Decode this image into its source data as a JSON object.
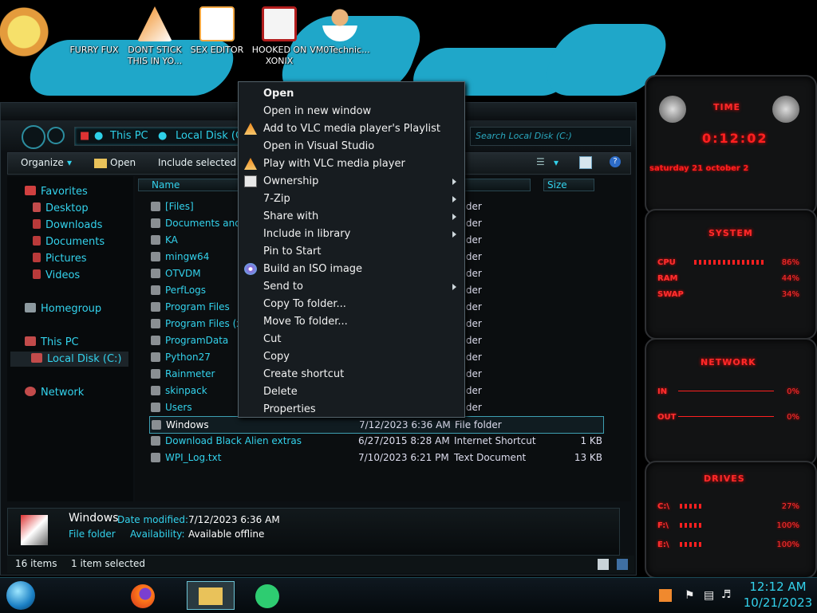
{
  "desktop": {
    "icons": [
      {
        "label": "FURRY FUX",
        "color": "#d83a2f"
      },
      {
        "label": "DONT STICK THIS IN YO...",
        "color": "#f08a1c"
      },
      {
        "label": "SEX EDITOR",
        "color": "#f2a640"
      },
      {
        "label": "HOOKED ON XONIX",
        "color": "#b31e1e"
      },
      {
        "label": "VM0Technic...",
        "color": "#e9b37a"
      }
    ]
  },
  "explorer": {
    "breadcrumb": [
      "This PC",
      "Local Disk (C:)"
    ],
    "search_placeholder": "Search Local Disk (C:)",
    "toolbar": {
      "organize": "Organize",
      "open": "Open",
      "include": "Include selected fol"
    },
    "columns": {
      "name": "Name",
      "type": "s",
      "size": "Size"
    },
    "nav": {
      "favorites": "Favorites",
      "desktop": "Desktop",
      "downloads": "Downloads",
      "documents": "Documents",
      "pictures": "Pictures",
      "videos": "Videos",
      "homegroup": "Homegroup",
      "thispc": "This PC",
      "localdisk": "Local Disk (C:)",
      "network": "Network"
    },
    "files": [
      {
        "name": "[Files]",
        "date": "",
        "type": "folder",
        "size": ""
      },
      {
        "name": "Documents and Se",
        "date": "",
        "type": "folder",
        "size": ""
      },
      {
        "name": "KA",
        "date": "",
        "type": "folder",
        "size": ""
      },
      {
        "name": "mingw64",
        "date": "",
        "type": "folder",
        "size": ""
      },
      {
        "name": "OTVDM",
        "date": "",
        "type": "folder",
        "size": ""
      },
      {
        "name": "PerfLogs",
        "date": "",
        "type": "folder",
        "size": ""
      },
      {
        "name": "Program Files",
        "date": "",
        "type": "folder",
        "size": ""
      },
      {
        "name": "Program Files (x86",
        "date": "",
        "type": "folder",
        "size": ""
      },
      {
        "name": "ProgramData",
        "date": "",
        "type": "folder",
        "size": ""
      },
      {
        "name": "Python27",
        "date": "",
        "type": "folder",
        "size": ""
      },
      {
        "name": "Rainmeter",
        "date": "",
        "type": "folder",
        "size": ""
      },
      {
        "name": "skinpack",
        "date": "",
        "type": "folder",
        "size": ""
      },
      {
        "name": "Users",
        "date": "",
        "type": "folder",
        "size": ""
      },
      {
        "name": "Windows",
        "date": "7/12/2023 6:36 AM",
        "type": "File folder",
        "size": ""
      },
      {
        "name": "Download Black Alien extras",
        "date": "6/27/2015 8:28 AM",
        "type": "Internet Shortcut",
        "size": "1 KB"
      },
      {
        "name": "WPI_Log.txt",
        "date": "7/10/2023 6:21 PM",
        "type": "Text Document",
        "size": "13 KB"
      }
    ],
    "details": {
      "name": "Windows",
      "modified_label": "Date modified:",
      "modified": "7/12/2023 6:36 AM",
      "kind": "File folder",
      "avail_label": "Availability:",
      "avail": "Available offline"
    },
    "status": {
      "items": "16 items",
      "selected": "1 item selected"
    }
  },
  "context_menu": [
    {
      "label": "Open",
      "bold": true
    },
    {
      "label": "Open in new window"
    },
    {
      "label": "Add to VLC media player's Playlist",
      "icon": "vlc-icon"
    },
    {
      "label": "Open in Visual Studio"
    },
    {
      "label": "Play with VLC media player",
      "icon": "vlc-icon"
    },
    {
      "label": "Ownership",
      "icon": "console-icon",
      "submenu": true
    },
    {
      "label": "7-Zip",
      "submenu": true
    },
    {
      "label": "Share with",
      "submenu": true
    },
    {
      "label": "Include in library",
      "submenu": true
    },
    {
      "label": "Pin to Start"
    },
    {
      "label": "Build an ISO image",
      "icon": "disc-icon"
    },
    {
      "label": "Send to",
      "submenu": true
    },
    {
      "label": "Copy To folder..."
    },
    {
      "label": "Move To folder..."
    },
    {
      "label": "Cut"
    },
    {
      "label": "Copy"
    },
    {
      "label": "Create shortcut"
    },
    {
      "label": "Delete"
    },
    {
      "label": "Properties"
    }
  ],
  "widgets": {
    "time": {
      "title": "TIME",
      "clock": "0:12:02",
      "date": "saturday 21 october 2"
    },
    "system": {
      "title": "SYSTEM",
      "cpu_label": "CPU",
      "cpu": "86%",
      "ram_label": "RAM",
      "ram": "44%",
      "swap_label": "SWAP",
      "swap": "34%"
    },
    "network": {
      "title": "NETWORK",
      "in_label": "IN",
      "in": "0%",
      "out_label": "OUT",
      "out": "0%"
    },
    "drives": {
      "title": "DRIVES",
      "c_label": "C:\\",
      "c": "27%",
      "f_label": "F:\\",
      "f": "100%",
      "e_label": "E:\\",
      "e": "100%"
    }
  },
  "taskbar": {
    "time": "12:12 AM",
    "date": "10/21/2023"
  },
  "colors": {
    "accent": "#33d2ec",
    "widget_red": "#ff2a2a",
    "menu_bg": "#171c20"
  }
}
